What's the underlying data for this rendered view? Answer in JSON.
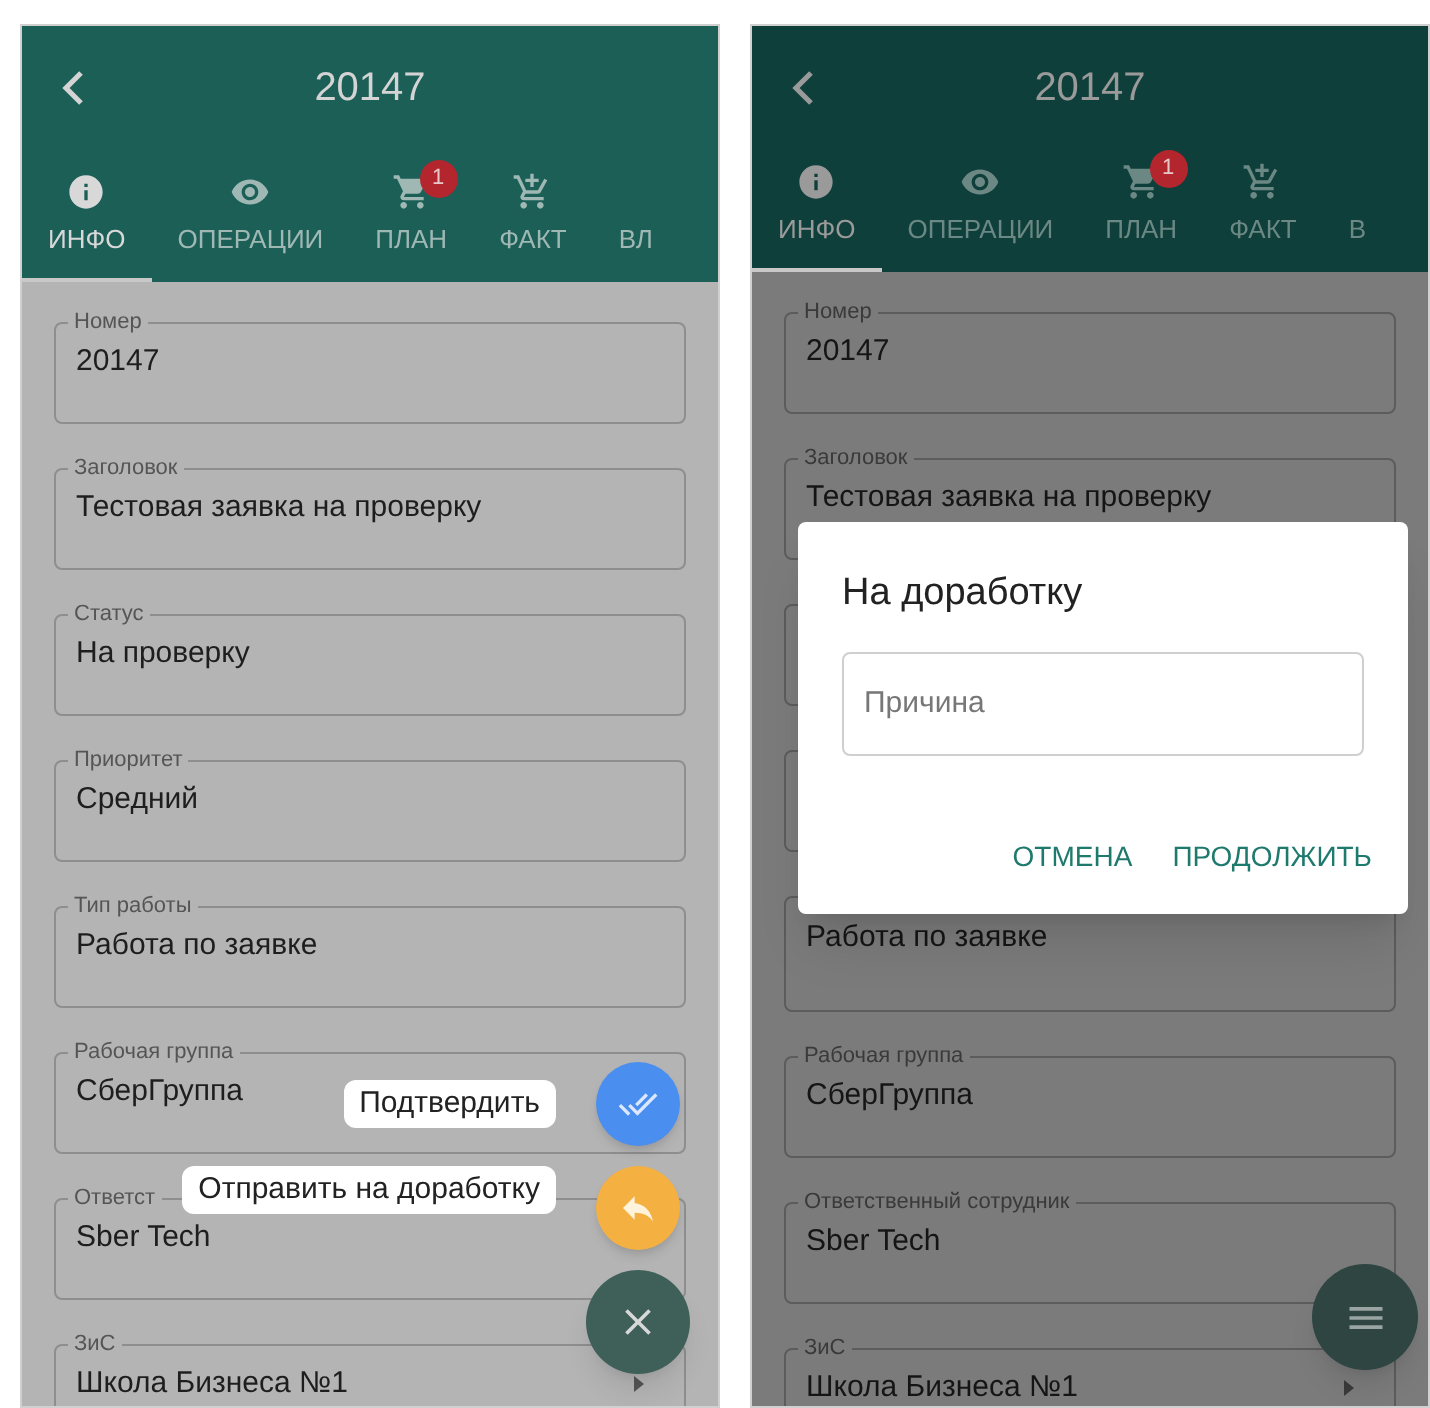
{
  "screens": [
    {
      "title": "20147",
      "tabs": [
        {
          "label": "ИНФО",
          "selected": true
        },
        {
          "label": "ОПЕРАЦИИ",
          "selected": false
        },
        {
          "label": "ПЛАН",
          "selected": false,
          "badge": "1"
        },
        {
          "label": "ФАКТ",
          "selected": false
        },
        {
          "label": "ВЛ",
          "selected": false
        }
      ],
      "fields": [
        {
          "label": "Номер",
          "value": "20147",
          "kind": "text"
        },
        {
          "label": "Заголовок",
          "value": "Тестовая заявка на проверку",
          "kind": "text"
        },
        {
          "label": "Статус",
          "value": "На проверку",
          "kind": "text"
        },
        {
          "label": "Приоритет",
          "value": "Средний",
          "kind": "text"
        },
        {
          "label": "Тип работы",
          "value": "Работа по заявке",
          "kind": "text"
        },
        {
          "label": "Рабочая группа",
          "value": "СберГруппа",
          "kind": "text"
        },
        {
          "label": "Ответст",
          "value": "Sber Tech",
          "kind": "text"
        },
        {
          "label": "ЗиС",
          "value": "Школа Бизнеса №1",
          "kind": "select"
        }
      ],
      "overlay": {
        "kind": "speed_dial",
        "actions": [
          {
            "label": "Подтвердить",
            "kind": "confirm"
          },
          {
            "label": "Отправить на доработку",
            "kind": "return"
          }
        ]
      }
    },
    {
      "title": "20147",
      "tabs": [
        {
          "label": "ИНФО",
          "selected": true
        },
        {
          "label": "ОПЕРАЦИИ",
          "selected": false
        },
        {
          "label": "ПЛАН",
          "selected": false,
          "badge": "1"
        },
        {
          "label": "ФАКТ",
          "selected": false
        },
        {
          "label": "В",
          "selected": false
        }
      ],
      "fields": [
        {
          "label": "Номер",
          "value": "20147",
          "kind": "text"
        },
        {
          "label": "Заголовок",
          "value": "Тестовая заявка на проверку",
          "kind": "text"
        },
        {
          "kind": "hidden"
        },
        {
          "kind": "hidden"
        },
        {
          "value": "Работа по заявке",
          "kind": "text"
        },
        {
          "label": "Рабочая группа",
          "value": "СберГруппа",
          "kind": "text"
        },
        {
          "label": "Ответственный сотрудник",
          "value": "Sber Tech",
          "kind": "text"
        },
        {
          "label": "ЗиС",
          "value": "Школа Бизнеса №1",
          "kind": "select"
        }
      ],
      "overlay": {
        "kind": "dialog",
        "title": "На доработку",
        "placeholder": "Причина",
        "buttons": [
          "ОТМЕНА",
          "ПРОДОЛЖИТЬ"
        ]
      }
    }
  ]
}
